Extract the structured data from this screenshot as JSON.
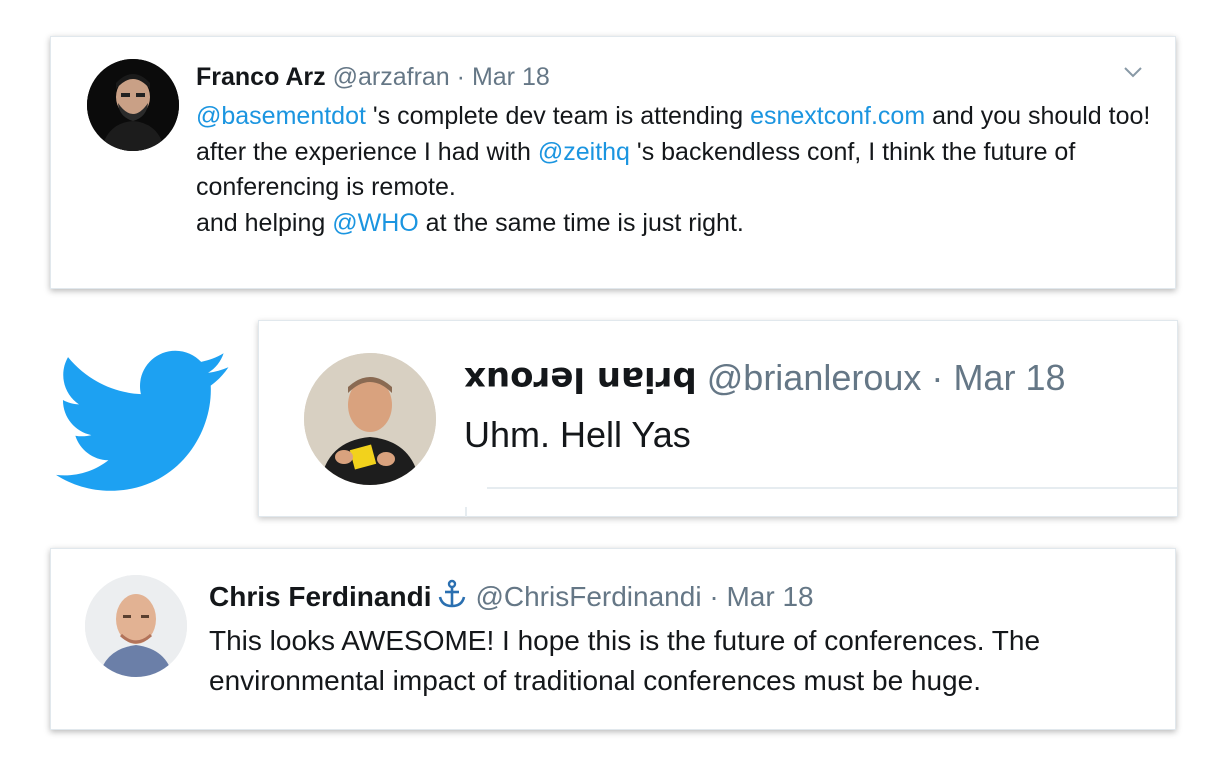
{
  "brand": {
    "logo_icon": "twitter-bird-icon",
    "logo_color": "#1da1f2"
  },
  "colors": {
    "link": "#1b95e0",
    "muted": "#657786",
    "text": "#14171a"
  },
  "tweets": [
    {
      "author_name": "Franco Arz",
      "handle": "@arzafran",
      "separator": "·",
      "date": "Mar 18",
      "menu_icon": "chevron-down-icon",
      "body": {
        "mention1": "@basementdot",
        "text1": " 's complete dev team is attending ",
        "link1": "esnextconf.com",
        "text2": " and you should too!",
        "text3": "after the experience I had with ",
        "mention2": "@zeithq",
        "text4": " 's backendless conf, I think the future of conferencing is remote.",
        "text5": "and helping ",
        "mention3": "@WHO",
        "text6": " at the same time is just right."
      }
    },
    {
      "author_name": "brian leroux",
      "handle": "@brianleroux",
      "separator": "·",
      "date": "Mar 18",
      "body": "Uhm. Hell Yas"
    },
    {
      "author_name": "Chris Ferdinandi",
      "name_emoji_icon": "anchor-icon",
      "handle": "@ChrisFerdinandi",
      "separator": "·",
      "date": "Mar 18",
      "body": "This looks AWESOME! I hope this is the future of conferences. The environmental impact of traditional conferences must be huge."
    }
  ]
}
